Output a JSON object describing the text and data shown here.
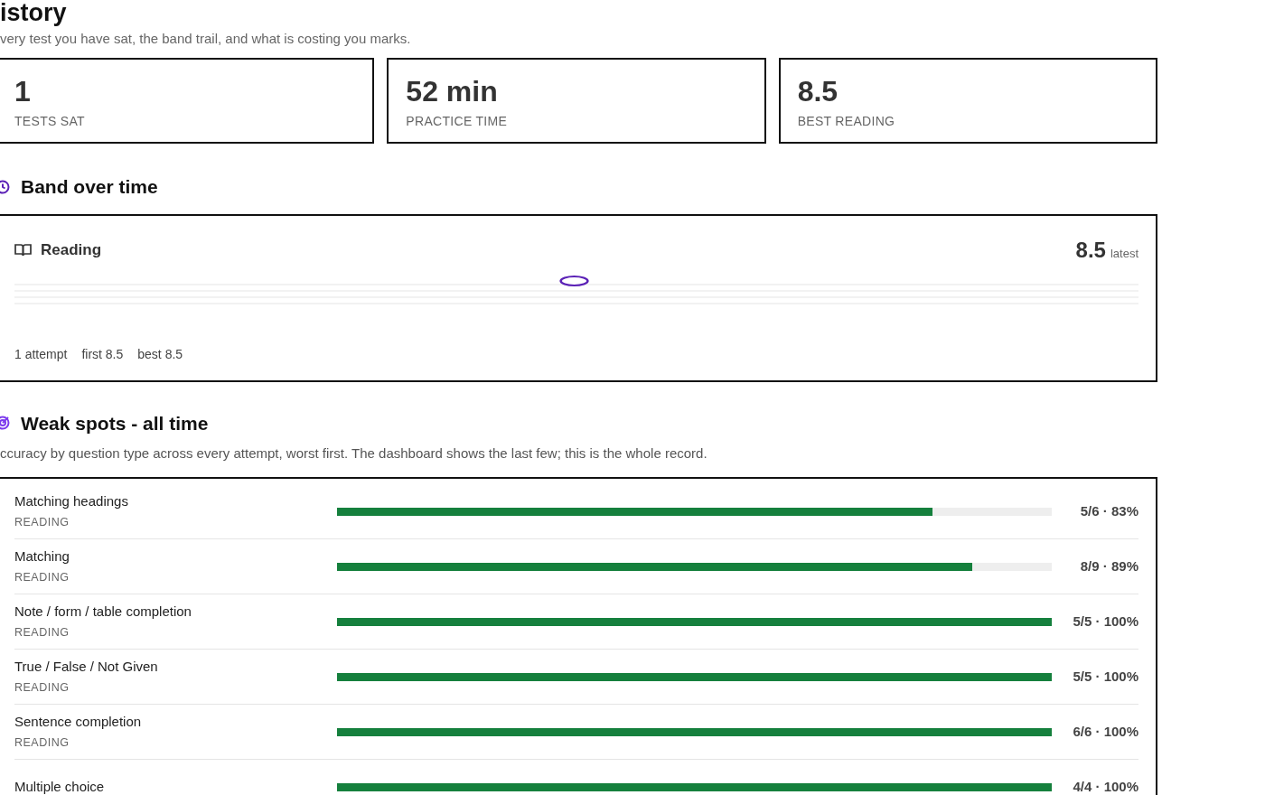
{
  "header": {
    "title": "istory",
    "subtitle": "very test you have sat, the band trail, and what is costing you marks."
  },
  "stats": [
    {
      "value": "1",
      "label": "TESTS SAT"
    },
    {
      "value": "52 min",
      "label": "PRACTICE TIME"
    },
    {
      "value": "8.5",
      "label": "BEST READING"
    }
  ],
  "band_section": {
    "title": "Band over time",
    "card": {
      "skill": "Reading",
      "latest_value": "8.5",
      "latest_label": "latest",
      "stats": [
        "1 attempt",
        "first 8.5",
        "best 8.5"
      ]
    }
  },
  "weak_section": {
    "title": "Weak spots - all time",
    "description": "ccuracy by question type across every attempt, worst first. The dashboard shows the last few; this is the whole record.",
    "rows": [
      {
        "name": "Matching headings",
        "category": "READING",
        "level": 0.833,
        "reading": "5/6 · 83%"
      },
      {
        "name": "Matching",
        "category": "READING",
        "level": 0.889,
        "reading": "8/9 · 89%"
      },
      {
        "name": "Note / form / table completion",
        "category": "READING",
        "level": 1,
        "reading": "5/5 · 100%"
      },
      {
        "name": "True / False / Not Given",
        "category": "READING",
        "level": 1,
        "reading": "5/5 · 100%"
      },
      {
        "name": "Sentence completion",
        "category": "READING",
        "level": 1,
        "reading": "6/6 · 100%"
      },
      {
        "name": "Multiple choice",
        "level": 1,
        "reading": "4/4 · 100%"
      }
    ]
  }
}
